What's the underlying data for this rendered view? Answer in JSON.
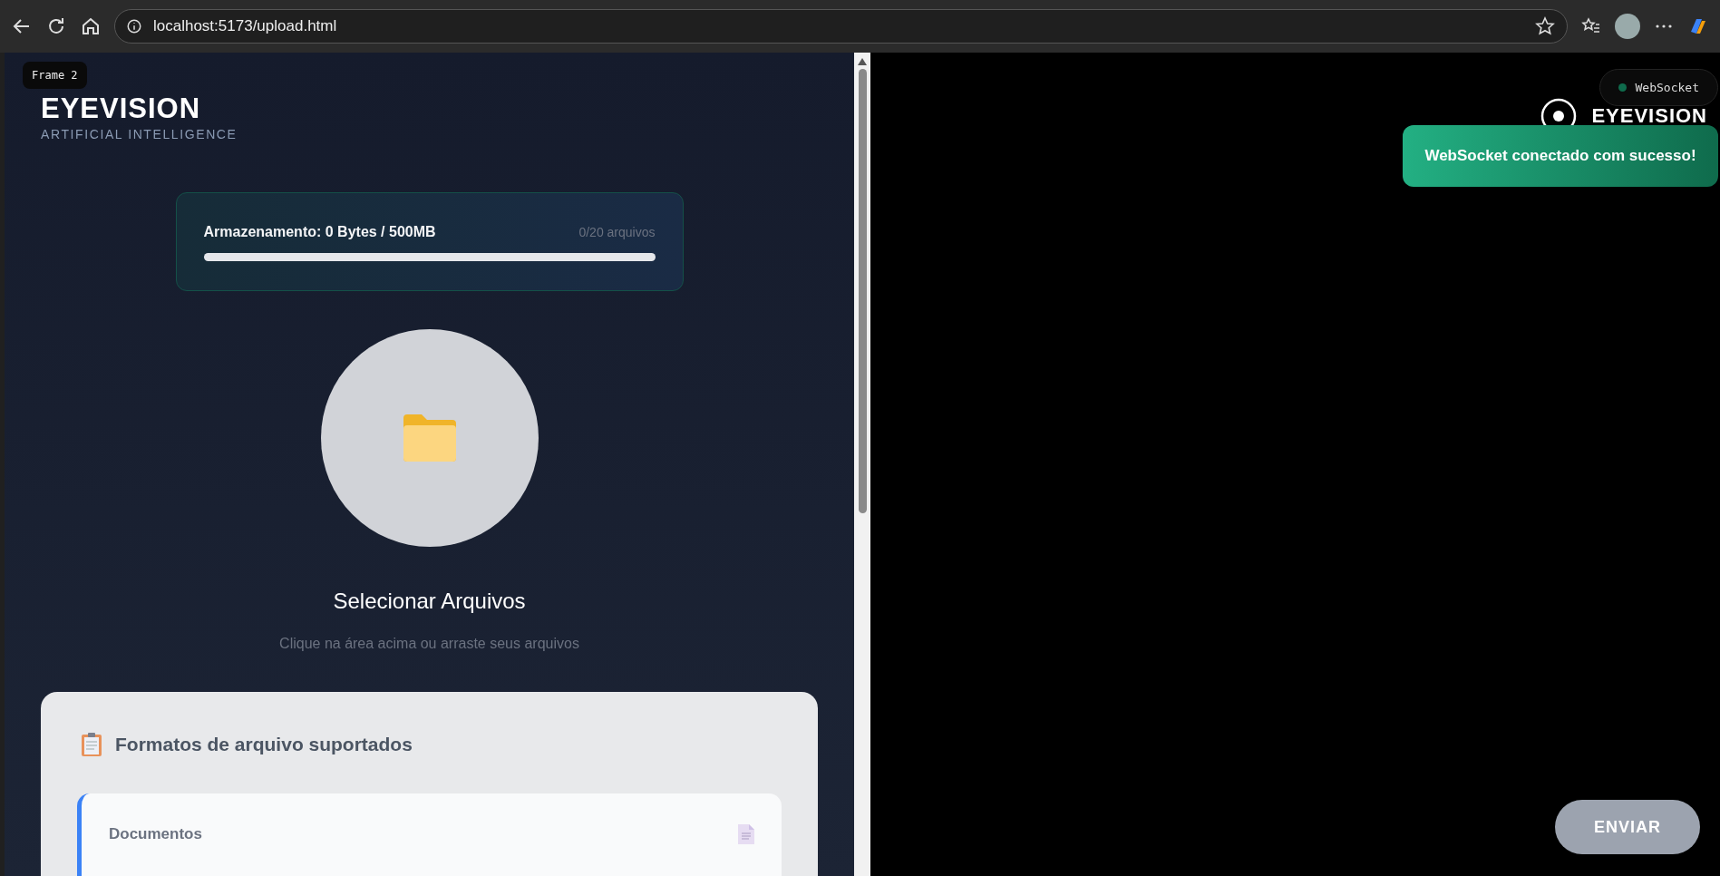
{
  "browser": {
    "url": "localhost:5173/upload.html"
  },
  "left": {
    "frame_badge": "Frame 2",
    "logo": "EYEVISION",
    "tagline": "ARTIFICIAL INTELLIGENCE",
    "storage": {
      "label": "Armazenamento: 0 Bytes / 500MB",
      "count": "0/20 arquivos",
      "level": 0
    },
    "upload": {
      "title": "Selecionar Arquivos",
      "hint": "Clique na área acima ou arraste seus arquivos"
    },
    "formats": {
      "title": "Formatos de arquivo suportados",
      "items": [
        {
          "name": "Documentos"
        }
      ]
    }
  },
  "right": {
    "logo": "EYEVISION",
    "status": {
      "label": "WebSocket",
      "color": "#0f6b4c"
    },
    "toast": "WebSocket conectado com sucesso!",
    "send_button": {
      "label": "ENVIAR",
      "disabled": true
    }
  }
}
